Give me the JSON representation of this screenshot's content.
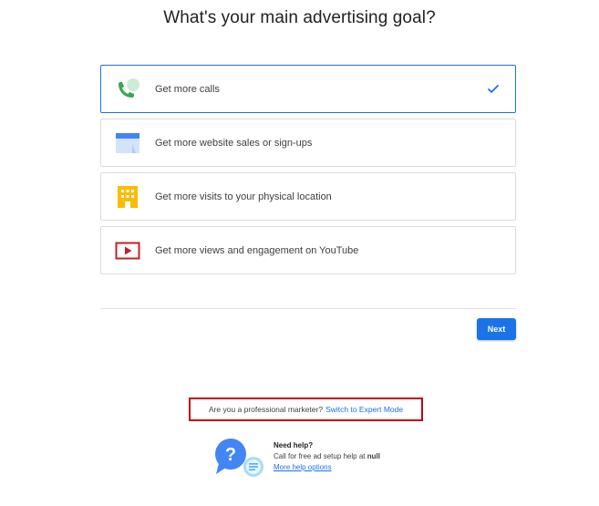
{
  "title": "What's your main advertising goal?",
  "goals": [
    {
      "label": "Get more calls",
      "icon": "phone-chat-icon",
      "selected": true
    },
    {
      "label": "Get more website sales or sign-ups",
      "icon": "browser-window-icon",
      "selected": false
    },
    {
      "label": "Get more visits to your physical location",
      "icon": "storefront-icon",
      "selected": false
    },
    {
      "label": "Get more views and engagement on YouTube",
      "icon": "youtube-play-icon",
      "selected": false
    }
  ],
  "next_label": "Next",
  "expert": {
    "question": "Are you a professional marketer?",
    "link": "Switch to Expert Mode"
  },
  "help": {
    "title": "Need help?",
    "line_prefix": "Call for free ad setup help at",
    "line_value": "null",
    "link": "More help options"
  },
  "colors": {
    "accent": "#1a73e8",
    "highlight_border": "#c5000f",
    "phone_green": "#34a853",
    "store_yellow": "#fbbc04",
    "youtube_red": "#c5221f"
  }
}
